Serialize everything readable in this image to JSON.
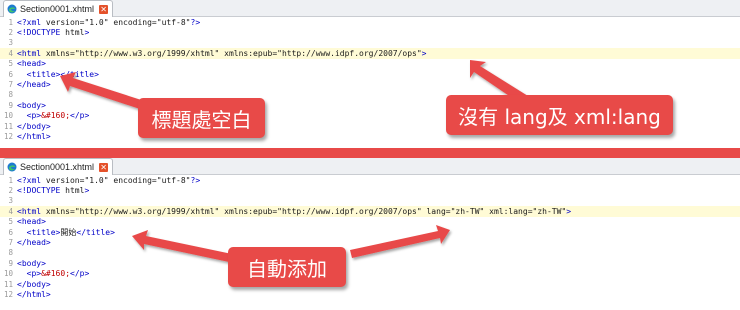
{
  "tab_title": "Section0001.xhtml",
  "tab_close_label": "✕",
  "top_code": [
    "<?xml version=\"1.0\" encoding=\"utf-8\"?>",
    "<!DOCTYPE html>",
    "",
    "<html xmlns=\"http://www.w3.org/1999/xhtml\" xmlns:epub=\"http://www.idpf.org/2007/ops\">",
    "<head>",
    "  <title></title>",
    "</head>",
    "",
    "<body>",
    "  <p>&#160;</p>",
    "</body>",
    "</html>"
  ],
  "bottom_code": [
    "<?xml version=\"1.0\" encoding=\"utf-8\"?>",
    "<!DOCTYPE html>",
    "",
    "<html xmlns=\"http://www.w3.org/1999/xhtml\" xmlns:epub=\"http://www.idpf.org/2007/ops\" lang=\"zh-TW\" xml:lang=\"zh-TW\">",
    "<head>",
    "  <title>開始</title>",
    "</head>",
    "",
    "<body>",
    "  <p>&#160;</p>",
    "</body>",
    "</html>"
  ],
  "line_numbers": [
    "1",
    "2",
    "3",
    "4",
    "5",
    "6",
    "7",
    "8",
    "9",
    "10",
    "11",
    "12"
  ],
  "top_highlight_line": 4,
  "bottom_highlight_line": 4,
  "callouts": {
    "title_blank": "標題處空白",
    "no_lang": "沒有 lang及 xml:lang",
    "auto_added": "自動添加"
  },
  "colors": {
    "callout_red": "#e84a48",
    "highlight": "#fffbd6",
    "tag_blue": "#0000c8",
    "attr_maroon": "#7a0000",
    "value_olive": "#808000"
  },
  "icons": [
    "edge-file-icon",
    "close-icon"
  ]
}
